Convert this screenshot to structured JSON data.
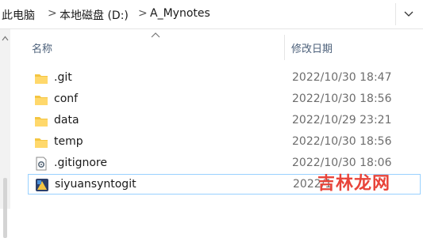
{
  "address_bar": {
    "crumbs": [
      "此电脑",
      "本地磁盘 (D:)",
      "A_Mynotes"
    ],
    "separator": ">"
  },
  "columns": {
    "name": "名称",
    "date_modified": "修改日期"
  },
  "files": [
    {
      "name": ".git",
      "date": "2022/10/30 18:47",
      "icon": "folder-icon"
    },
    {
      "name": "conf",
      "date": "2022/10/30 18:56",
      "icon": "folder-icon"
    },
    {
      "name": "data",
      "date": "2022/10/29 23:21",
      "icon": "folder-icon"
    },
    {
      "name": "temp",
      "date": "2022/10/30 18:56",
      "icon": "folder-icon"
    },
    {
      "name": ".gitignore",
      "date": "2022/10/30 18:06",
      "icon": "settings-file-icon"
    },
    {
      "name": "siyuansyntogit",
      "date": "2022/1",
      "icon": "app-icon"
    }
  ],
  "watermark": {
    "text": "吉林龙网"
  },
  "colors": {
    "folder": "#f4c542",
    "header_text": "#4c607a",
    "date_text": "#6d6d6d",
    "selection_border": "#99d1ff",
    "watermark": "#e8443a"
  }
}
